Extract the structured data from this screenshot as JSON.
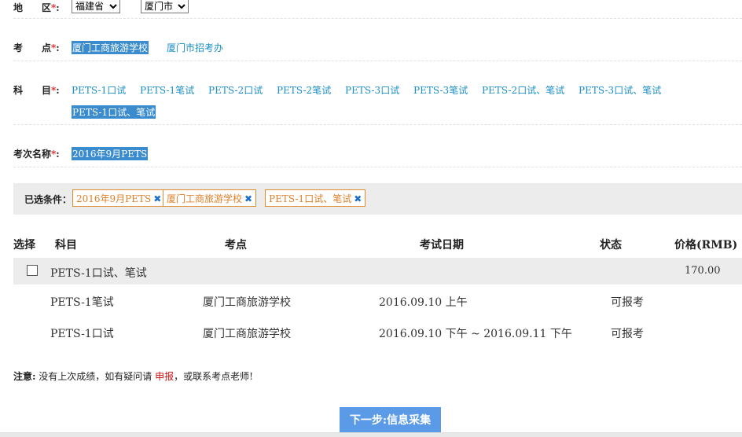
{
  "region": {
    "label": "地　　区",
    "required_mark": "*",
    "colon": ":",
    "province": {
      "selected": "福建省",
      "options": [
        "福建省"
      ]
    },
    "city": {
      "selected": "厦门市",
      "options": [
        "厦门市"
      ]
    }
  },
  "exam_site": {
    "label": "考　　点",
    "required_mark": "*",
    "colon": ":",
    "options": [
      "厦门工商旅游学校",
      "厦门市招考办"
    ],
    "selected_index": 0
  },
  "subject": {
    "label": "科　　目",
    "required_mark": "*",
    "colon": ":",
    "options": [
      "PETS-1口试",
      "PETS-1笔试",
      "PETS-2口试",
      "PETS-2笔试",
      "PETS-3口试",
      "PETS-3笔试",
      "PETS-2口试、笔试",
      "PETS-3口试、笔试",
      "PETS-1口试、笔试"
    ],
    "selected_index": 8
  },
  "session": {
    "label": "考次名称",
    "required_mark": "*",
    "colon": ":",
    "options": [
      "2016年9月PETS"
    ],
    "selected_index": 0
  },
  "conditions": {
    "label": "已选条件：",
    "tags": [
      "2016年9月PETS",
      "厦门工商旅游学校",
      "PETS-1口试、笔试"
    ],
    "remove_glyph": "✖"
  },
  "table": {
    "headers": {
      "select": "选择",
      "subject": "科目",
      "site": "考点",
      "date": "考试日期",
      "status": "状态",
      "price": "价格(RMB)"
    },
    "group": {
      "subject": "PETS-1口试、笔试",
      "price": "170.00",
      "checked": false
    },
    "rows": [
      {
        "subject": "PETS-1笔试",
        "site": "厦门工商旅游学校",
        "date": "2016.09.10 上午",
        "status": "可报考"
      },
      {
        "subject": "PETS-1口试",
        "site": "厦门工商旅游学校",
        "date": "2016.09.10 下午 ~ 2016.09.11 下午",
        "status": "可报考"
      }
    ]
  },
  "note": {
    "label": "注意:",
    "text_before": " 没有上次成绩，如有疑问请 ",
    "link": "申报",
    "text_after": "，或联系考点老师!"
  },
  "next_button": "下一步:信息采集",
  "colors": {
    "link": "#1a8ec7",
    "selected_bg": "#3a8ccf",
    "tag_border": "#e08a2e",
    "button_bg": "#5a9ae6",
    "required": "#e02020"
  }
}
